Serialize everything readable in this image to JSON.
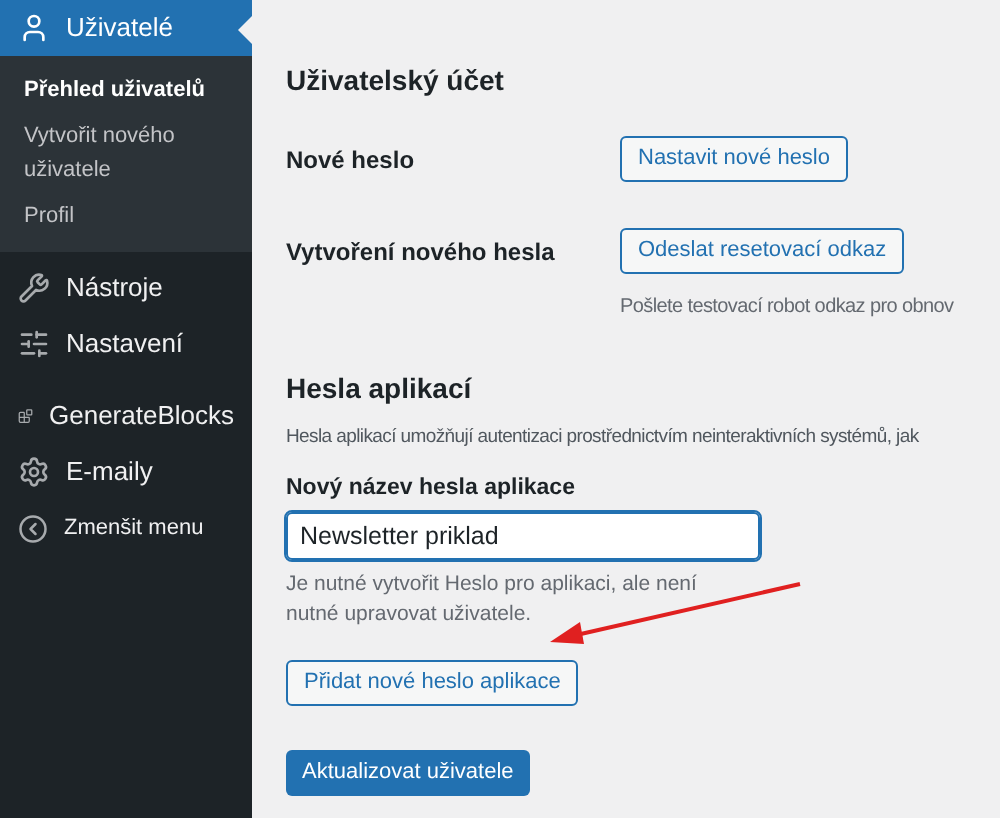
{
  "sidebar": {
    "items": [
      {
        "label": "Uživatelé",
        "selected": true,
        "children": [
          {
            "label": "Přehled uživatelů",
            "selected": true
          },
          {
            "label": "Vytvořit nového uživatele",
            "selected": false
          },
          {
            "label": "Profil",
            "selected": false
          }
        ]
      },
      {
        "label": "Nástroje",
        "selected": false
      },
      {
        "label": "Nastavení",
        "selected": false
      },
      {
        "label": "GenerateBlocks",
        "selected": false
      },
      {
        "label": "E-maily",
        "selected": false
      },
      {
        "label": "Zmenšit menu",
        "selected": false
      }
    ]
  },
  "account": {
    "heading": "Uživatelský účet",
    "rows": [
      {
        "label": "Nové heslo",
        "button": "Nastavit nové heslo"
      },
      {
        "label": "Vytvoření nového hesla",
        "button": "Odeslat resetovací odkaz",
        "description": "Pošlete testovací robot odkaz pro obnov"
      }
    ]
  },
  "app_passwords": {
    "heading": "Hesla aplikací",
    "description": "Hesla aplikací umožňují autentizaci prostřednictvím neinteraktivních systémů, jak",
    "field_label": "Nový název hesla aplikace",
    "field_value": "Newsletter priklad",
    "hint": "Je nutné vytvořit Heslo pro aplikaci, ale není nutné upravovat uživatele.",
    "add_button": "Přidat nové heslo aplikace"
  },
  "submit_button": "Aktualizovat uživatele"
}
